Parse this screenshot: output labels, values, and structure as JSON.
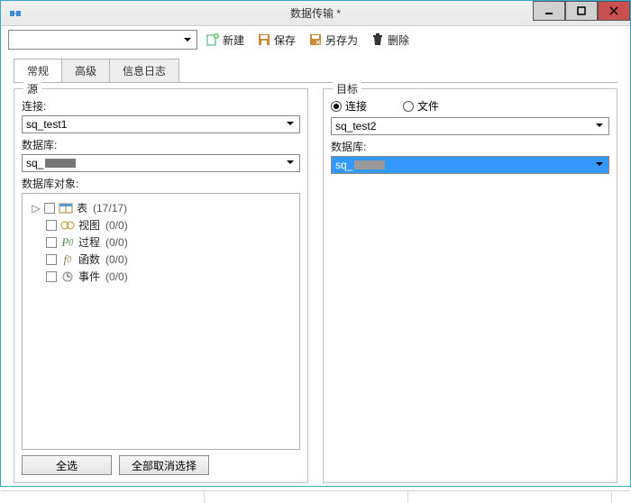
{
  "window": {
    "title": "数据传输 *"
  },
  "toolbar": {
    "profile": "",
    "new": "新建",
    "save": "保存",
    "save_as": "另存为",
    "delete": "删除"
  },
  "tabs": {
    "general": "常规",
    "advanced": "高级",
    "log": "信息日志"
  },
  "source": {
    "title": "源",
    "connection_label": "连接:",
    "connection_value": "sq_test1",
    "database_label": "数据库:",
    "database_value": "sq_",
    "objects_label": "数据库对象:",
    "items": {
      "tables": {
        "label": "表",
        "count": "(17/17)"
      },
      "views": {
        "label": "视图",
        "count": "(0/0)"
      },
      "procs": {
        "label": "过程",
        "count": "(0/0)"
      },
      "funcs": {
        "label": "函数",
        "count": "(0/0)"
      },
      "events": {
        "label": "事件",
        "count": "(0/0)"
      }
    },
    "select_all": "全选",
    "deselect_all": "全部取消选择"
  },
  "target": {
    "title": "目标",
    "radio_connection": "连接",
    "radio_file": "文件",
    "connection_value": "sq_test2",
    "database_label": "数据库:",
    "database_value": "sq_"
  }
}
